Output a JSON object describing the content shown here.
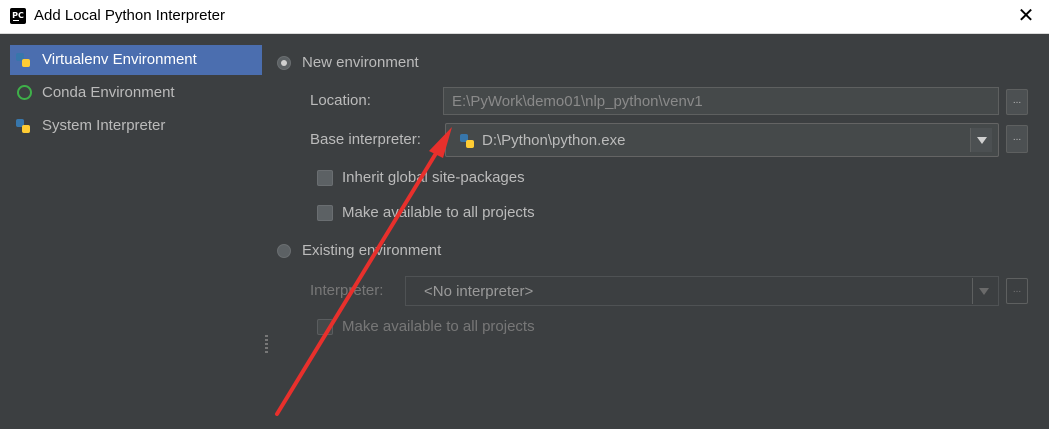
{
  "window": {
    "title": "Add Local Python Interpreter",
    "app_icon_text": "PC",
    "close_glyph": "✕"
  },
  "sidebar": {
    "items": [
      {
        "label": "Virtualenv Environment",
        "icon": "python-icon",
        "selected": true
      },
      {
        "label": "Conda Environment",
        "icon": "conda-icon",
        "selected": false
      },
      {
        "label": "System Interpreter",
        "icon": "python-icon",
        "selected": false
      }
    ]
  },
  "new_env": {
    "radio_label": "New environment",
    "selected": true,
    "location": {
      "label": "Location:",
      "value": "E:\\PyWork\\demo01\\nlp_python\\venv1",
      "browse": "..."
    },
    "base_interpreter": {
      "label": "Base interpreter:",
      "value": "D:\\Python\\python.exe",
      "browse": "..."
    },
    "inherit_label": "Inherit global site-packages",
    "inherit_checked": false,
    "available_label": "Make available to all projects",
    "available_checked": false
  },
  "existing_env": {
    "radio_label": "Existing environment",
    "selected": false,
    "interpreter": {
      "label": "Interpreter:",
      "value": "<No interpreter>",
      "browse": "..."
    },
    "available_label": "Make available to all projects",
    "available_checked": false
  },
  "colors": {
    "annotation_arrow": "#e8302c",
    "selection": "#4b6eaf",
    "background": "#3c3f41"
  }
}
